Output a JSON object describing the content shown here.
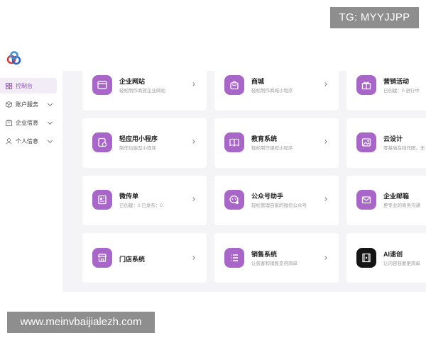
{
  "watermarks": {
    "top": "TG: MYYJJPP",
    "bottom": "www.meinvbaijialezh.com"
  },
  "sidebar": {
    "items": [
      {
        "label": "控制台",
        "icon": "grid-icon",
        "active": true
      },
      {
        "label": "账户服务",
        "icon": "box-icon",
        "expandable": true
      },
      {
        "label": "企业信息",
        "icon": "building-icon",
        "expandable": true
      },
      {
        "label": "个人信息",
        "icon": "person-icon",
        "expandable": true
      }
    ]
  },
  "cards": [
    {
      "title": "企业网站",
      "subtitle": "轻松制作商旅企业网站",
      "icon": "website-icon"
    },
    {
      "title": "商城",
      "subtitle": "轻松制作商城小程序",
      "icon": "shopping-bag-icon"
    },
    {
      "title": "营销活动",
      "subtitle": "已创建：0   进行中",
      "icon": "gift-icon"
    },
    {
      "title": "轻应用小程序",
      "subtitle": "制作功能型小程序",
      "icon": "mini-program-icon"
    },
    {
      "title": "教育系统",
      "subtitle": "轻松制作课程小程序",
      "icon": "book-icon"
    },
    {
      "title": "云设计",
      "subtitle": "零基础在线作图、无",
      "icon": "image-icon"
    },
    {
      "title": "微传单",
      "subtitle": "已创建：0    已发布：0",
      "icon": "flyer-icon"
    },
    {
      "title": "公众号助手",
      "subtitle": "轻松管理自家的微信公众号",
      "icon": "chat-icon"
    },
    {
      "title": "企业邮箱",
      "subtitle": "更专业的商务沟通",
      "icon": "mail-icon"
    },
    {
      "title": "门店系统",
      "subtitle": "",
      "icon": "store-icon"
    },
    {
      "title": "销售系统",
      "subtitle": "让获客和销售变得简单",
      "icon": "list-icon"
    },
    {
      "title": "AI速创",
      "subtitle": "让内容获客更简单",
      "icon": "film-icon"
    }
  ],
  "colors": {
    "accent": "#a966c9",
    "active_bg": "#f1ecf6",
    "content_bg": "#f4f4f6"
  }
}
